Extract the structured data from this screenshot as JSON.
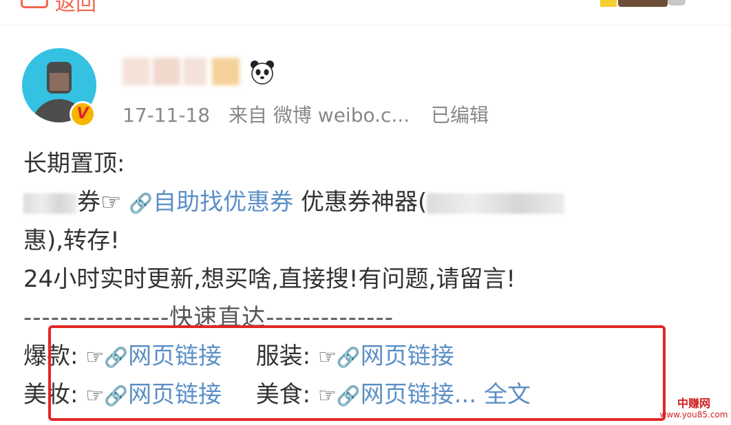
{
  "header": {
    "back_label": "返回"
  },
  "post": {
    "timestamp": "17-11-18",
    "source": "来自 微博 weibo.c...",
    "edited": "已编辑",
    "lines": {
      "l1": "长期置顶:",
      "l2_suffix": "券☞",
      "l2_link": "自助找优惠券",
      "l2_rest": " 优惠券神器(",
      "l3": "惠),转存!",
      "l4": "24小时实时更新,想买啥,直接搜!有问题,请留言!",
      "l5": "----------------快速直达--------------"
    },
    "categories": [
      {
        "label": "爆款:",
        "hand": "☞",
        "link": "网页链接"
      },
      {
        "label": "服装:",
        "hand": "☞",
        "link": "网页链接"
      },
      {
        "label": "美妆:",
        "hand": "☞",
        "link": "网页链接"
      },
      {
        "label": "美食:",
        "hand": "☞",
        "link": "网页链接..."
      }
    ],
    "full_text": "全文"
  },
  "watermark": {
    "name": "中赚网",
    "url": "www.you85.com"
  },
  "colors": {
    "link": "#5b8fc6",
    "accent": "#f2674c",
    "highlight": "#e32626"
  }
}
